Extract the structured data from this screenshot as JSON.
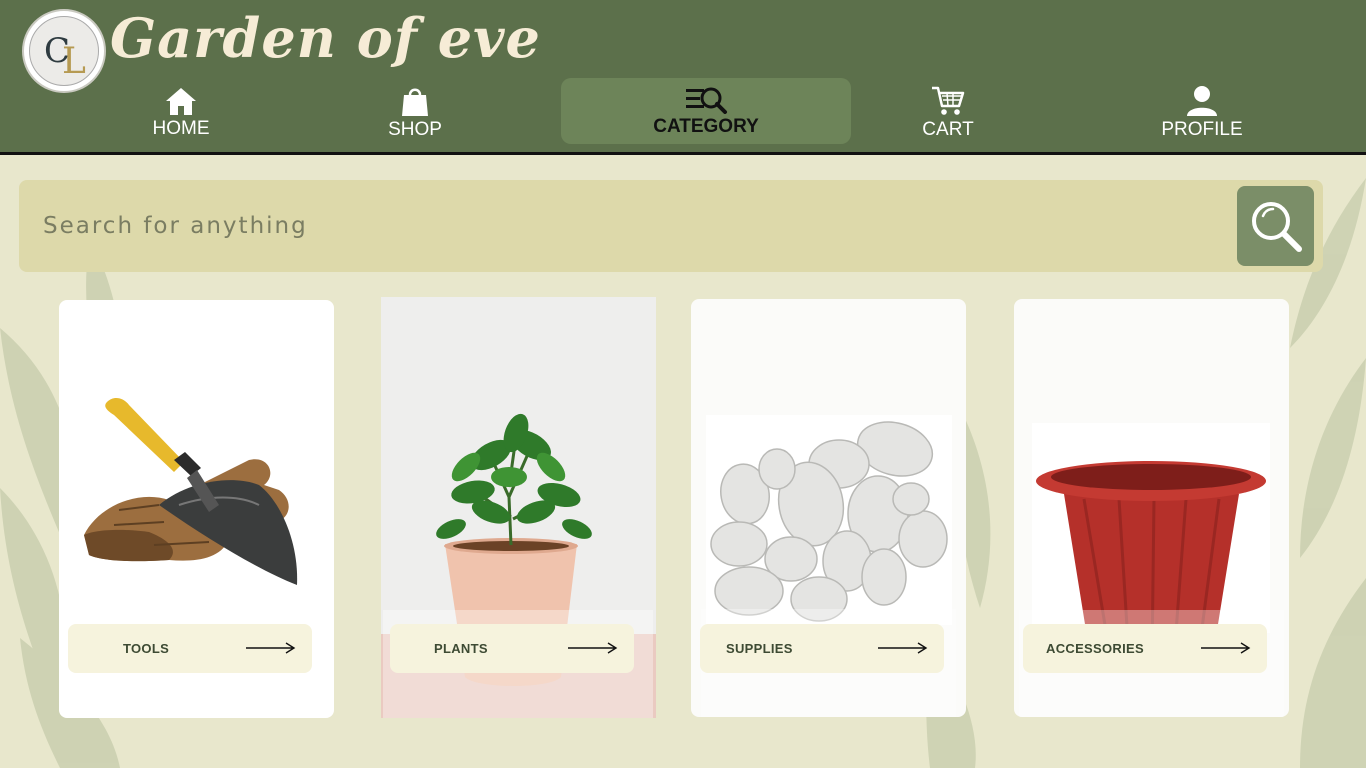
{
  "brand": {
    "name": "Garden of eve",
    "logo_letters": [
      "C",
      "L"
    ]
  },
  "nav": {
    "items": [
      {
        "label": "HOME",
        "icon": "home-icon"
      },
      {
        "label": "SHOP",
        "icon": "shopping-bag-icon"
      },
      {
        "label": "CATEGORY",
        "icon": "category-search-icon"
      },
      {
        "label": "CART",
        "icon": "cart-icon"
      },
      {
        "label": "PROFILE",
        "icon": "user-icon"
      }
    ],
    "active": "CATEGORY"
  },
  "search": {
    "placeholder": "Search for anything",
    "value": "",
    "icon": "search-icon"
  },
  "categories": [
    {
      "label": "TOOLS",
      "image": "trowel-and-gloves"
    },
    {
      "label": "PLANTS",
      "image": "potted-plant"
    },
    {
      "label": "SUPPLIES",
      "image": "white-pebbles"
    },
    {
      "label": "ACCESSORIES",
      "image": "red-plant-pot"
    }
  ],
  "colors": {
    "header": "#5c704b",
    "active_tab": "#6d8459",
    "page_bg": "#e8e7cc",
    "search_bg": "#ddd9aa",
    "search_button": "#7b8e68",
    "label_bg": "#f6f3dd"
  }
}
